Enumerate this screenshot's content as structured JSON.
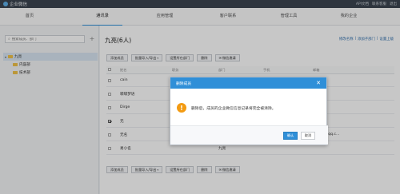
{
  "topbar": {
    "app_name": "企业微信",
    "links": [
      "API文档",
      "联系客服",
      "退出"
    ]
  },
  "nav": {
    "tabs": [
      "首页",
      "通讯录",
      "应用管理",
      "客户联系",
      "管理工具",
      "我的企业"
    ]
  },
  "sidebar": {
    "search_placeholder": "搜索成员、部门",
    "tree": [
      {
        "label": "九亮"
      },
      {
        "label": "内容部"
      },
      {
        "label": "技术部"
      }
    ]
  },
  "main": {
    "title": "九亮(6人)",
    "top_links": [
      "修改名称",
      "|",
      "添加子部门",
      "|",
      "设置上级"
    ],
    "toolbar": {
      "add_member": "添加成员",
      "batch": "批量导入/导出",
      "set_dept": "设置所在部门",
      "delete": "删除",
      "wechat_invite": "微信邀请"
    },
    "columns": {
      "name": "姓名",
      "position": "职务",
      "department": "部门",
      "phone": "手机",
      "email": "邮箱"
    },
    "rows": [
      {
        "name": "cain",
        "department": "",
        "email": "",
        "checked": false
      },
      {
        "name": "啸啸梦语",
        "department": "",
        "email": "",
        "checked": false
      },
      {
        "name": "Dirge",
        "department": "",
        "email": "",
        "checked": false
      },
      {
        "name": "无",
        "department": "",
        "email": "",
        "checked": true
      },
      {
        "name": "无名",
        "department": "",
        "email": "76514@qq.c...",
        "checked": false
      },
      {
        "name": "易小名",
        "department": "九亮",
        "email": "",
        "checked": false
      }
    ]
  },
  "dialog": {
    "title": "删除成员",
    "message": "删除后，成员的企业微信信息记录将完全被清除。",
    "confirm": "确认",
    "cancel": "取消"
  }
}
